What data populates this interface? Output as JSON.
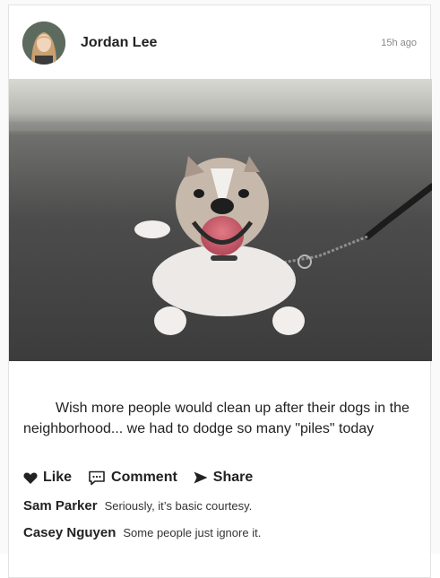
{
  "post": {
    "author": "Jordan Lee",
    "timestamp": "15h ago",
    "caption": "Wish more people would clean up after their dogs in the neighborhood... we had to dodge so many \"piles\" today"
  },
  "actions": {
    "like_label": "Like",
    "comment_label": "Comment",
    "share_label": "Share"
  },
  "comments": [
    {
      "author": "Sam Parker",
      "text": "Seriously, it’s basic courtesy."
    },
    {
      "author": "Casey Nguyen",
      "text": "Some people just ignore it."
    }
  ]
}
